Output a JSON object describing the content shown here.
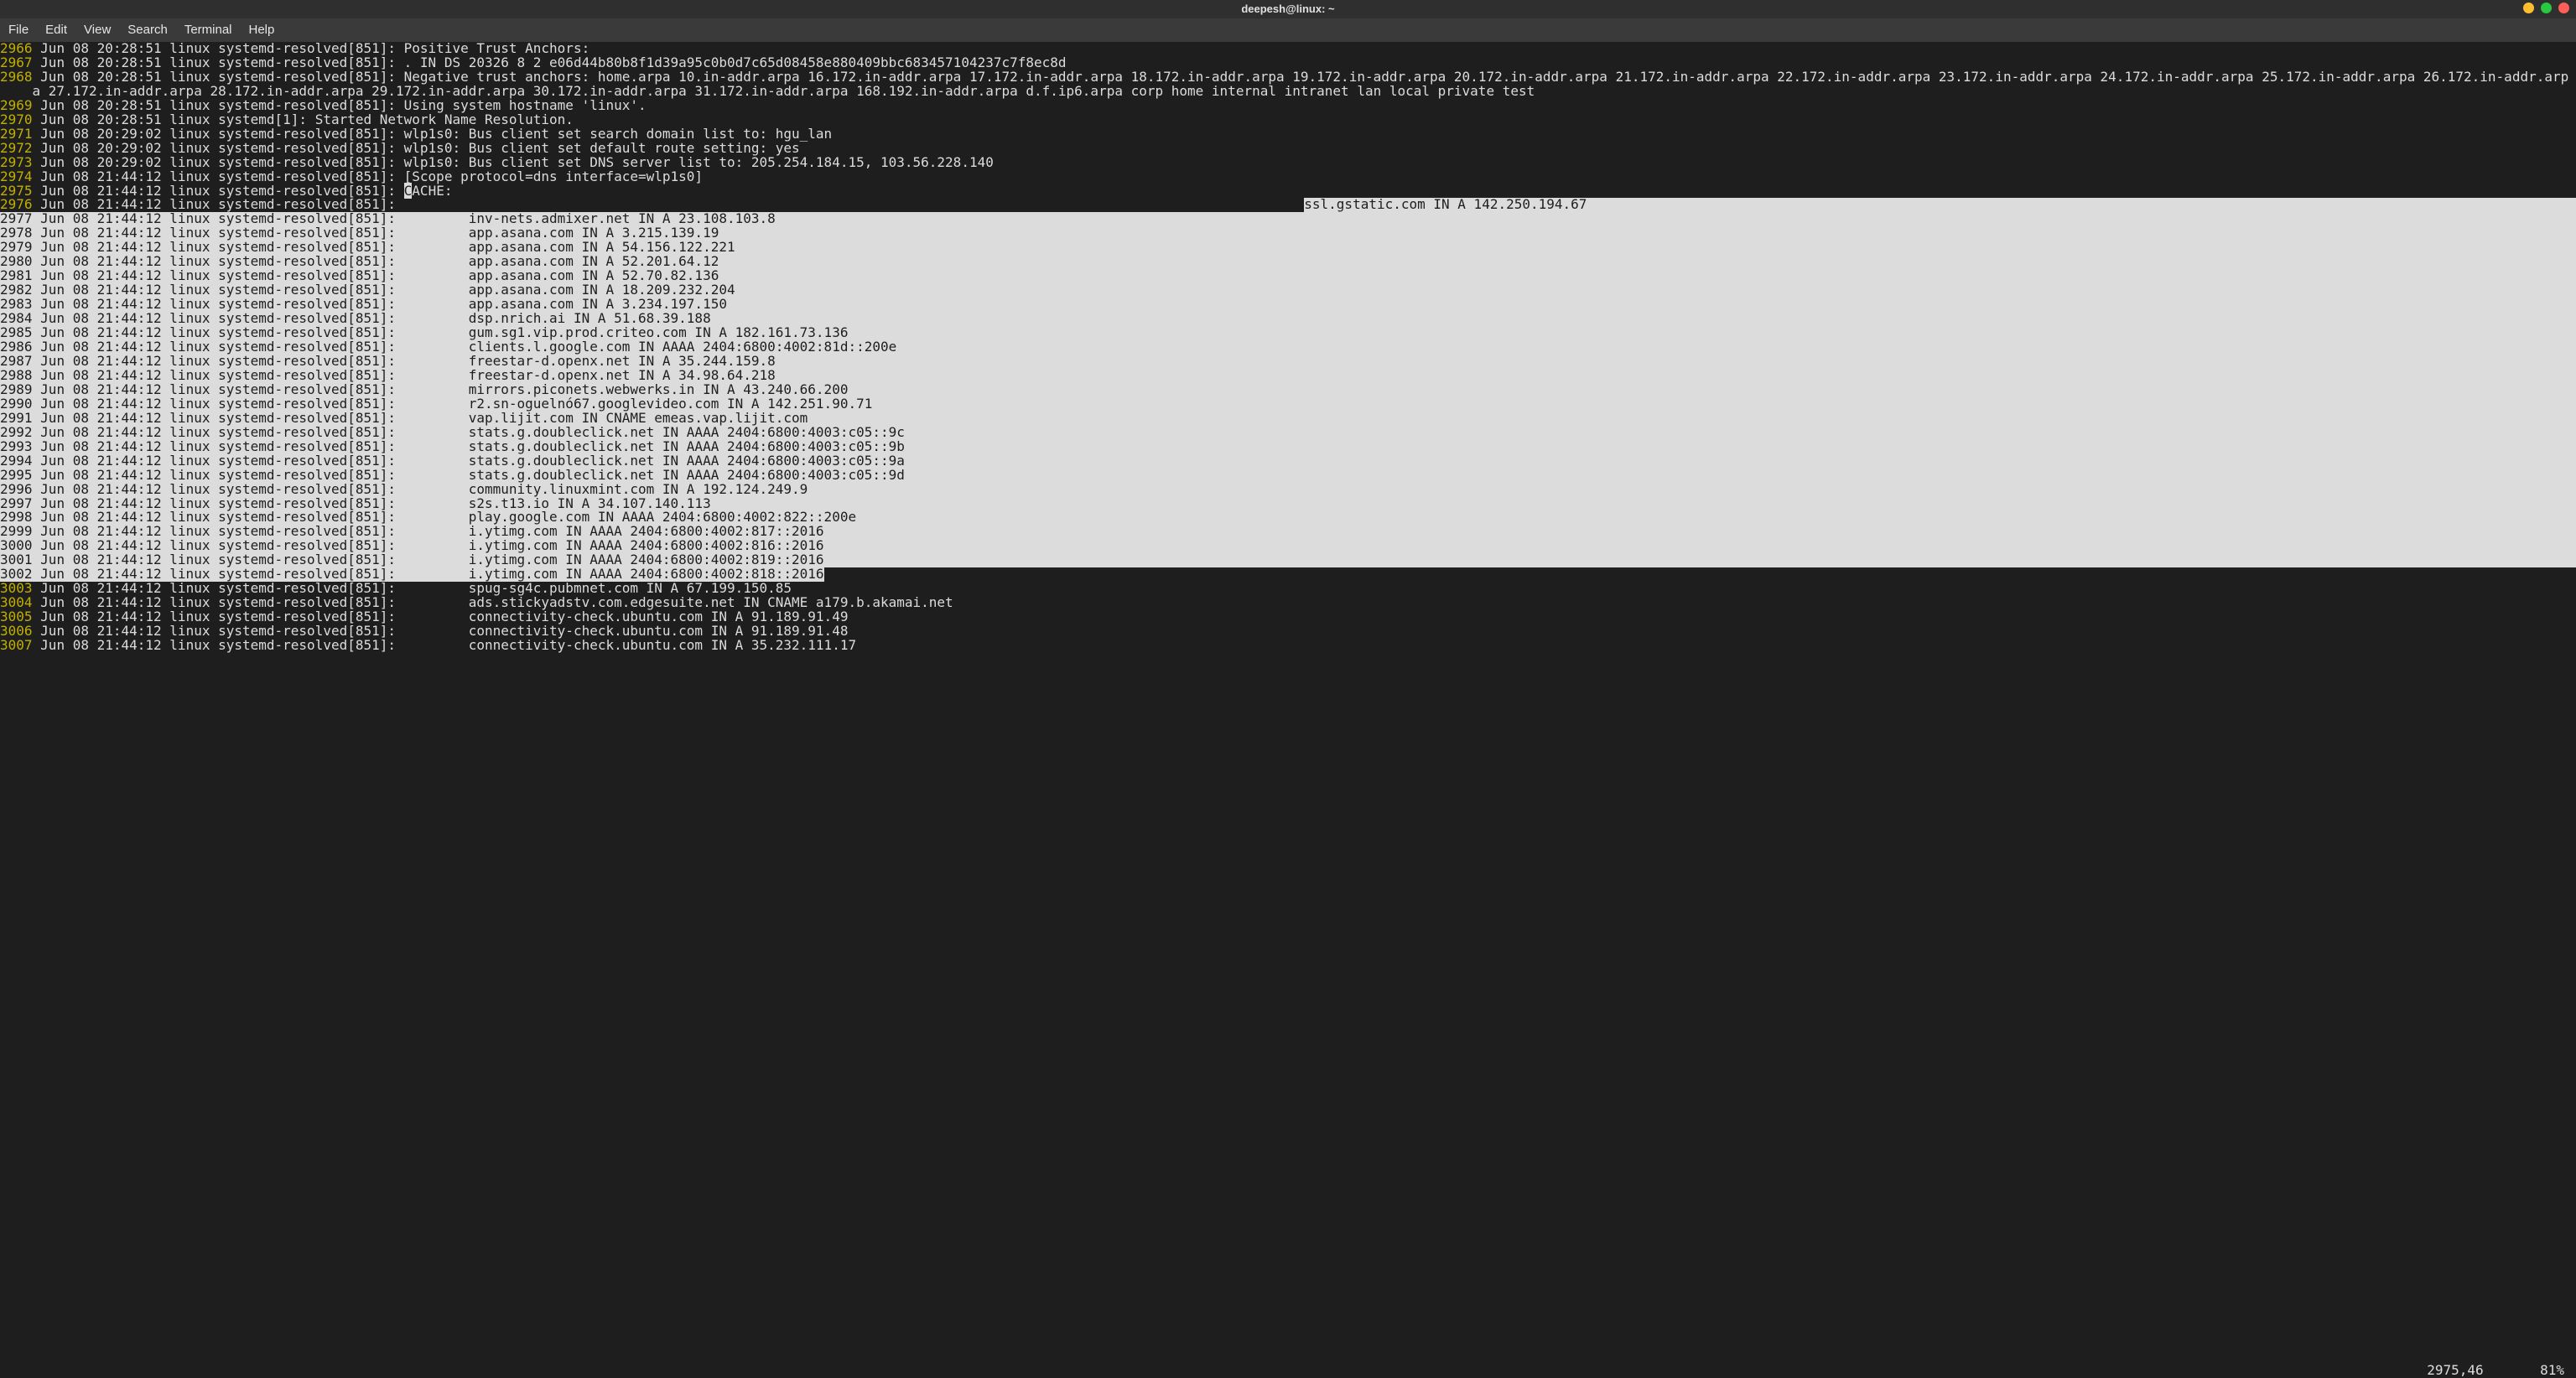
{
  "window": {
    "title": "deepesh@linux: ~"
  },
  "menubar": {
    "file": "File",
    "edit": "Edit",
    "view": "View",
    "search": "Search",
    "terminal": "Terminal",
    "help": "Help"
  },
  "status": {
    "pos": "2975,46",
    "pct": "81%"
  },
  "prefix_default": "Jun 08 21:44:12 linux systemd-resolved[851]:",
  "lines": [
    {
      "n": "2966",
      "text": "Jun 08 20:28:51 linux systemd-resolved[851]: Positive Trust Anchors:"
    },
    {
      "n": "2967",
      "text": "Jun 08 20:28:51 linux systemd-resolved[851]: . IN DS 20326 8 2 e06d44b80b8f1d39a95c0b0d7c65d08458e880409bbc683457104237c7f8ec8d"
    },
    {
      "n": "2968",
      "text": "Jun 08 20:28:51 linux systemd-resolved[851]: Negative trust anchors: home.arpa 10.in-addr.arpa 16.172.in-addr.arpa 17.172.in-addr.arpa 18.172.in-addr.arpa 19.172.in-addr.arpa 20.172.in-addr.arpa 21.172.in-addr.arpa 22.172.in-addr.arpa 23.172.in-addr.arpa 24.172.in-addr.arpa 25.172.in-addr.arpa 26.172.in-addr.arpa 27.172.in-addr.arpa 28.172.in-addr.arpa 29.172.in-addr.arpa 30.172.in-addr.arpa 31.172.in-addr.arpa 168.192.in-addr.arpa d.f.ip6.arpa corp home internal intranet lan local private test"
    },
    {
      "n": "2969",
      "text": "Jun 08 20:28:51 linux systemd-resolved[851]: Using system hostname 'linux'."
    },
    {
      "n": "2970",
      "text": "Jun 08 20:28:51 linux systemd[1]: Started Network Name Resolution."
    },
    {
      "n": "2971",
      "text": "Jun 08 20:29:02 linux systemd-resolved[851]: wlp1s0: Bus client set search domain list to: hgu_lan"
    },
    {
      "n": "2972",
      "text": "Jun 08 20:29:02 linux systemd-resolved[851]: wlp1s0: Bus client set default route setting: yes"
    },
    {
      "n": "2973",
      "text": "Jun 08 20:29:02 linux systemd-resolved[851]: wlp1s0: Bus client set DNS server list to: 205.254.184.15, 103.56.228.140"
    },
    {
      "n": "2974",
      "text": "Jun 08 21:44:12 linux systemd-resolved[851]: [Scope protocol=dns interface=wlp1s0]"
    }
  ],
  "cache_line": {
    "n": "2975",
    "cursor_char": "C",
    "rest": "ACHE:"
  },
  "selected_header": {
    "n": "2976",
    "rec": "ssl.gstatic.com IN A 142.250.194.67"
  },
  "selected": [
    {
      "n": "2977",
      "rec": "inv-nets.admixer.net IN A 23.108.103.8"
    },
    {
      "n": "2978",
      "rec": "app.asana.com IN A 3.215.139.19"
    },
    {
      "n": "2979",
      "rec": "app.asana.com IN A 54.156.122.221"
    },
    {
      "n": "2980",
      "rec": "app.asana.com IN A 52.201.64.12"
    },
    {
      "n": "2981",
      "rec": "app.asana.com IN A 52.70.82.136"
    },
    {
      "n": "2982",
      "rec": "app.asana.com IN A 18.209.232.204"
    },
    {
      "n": "2983",
      "rec": "app.asana.com IN A 3.234.197.150"
    },
    {
      "n": "2984",
      "rec": "dsp.nrich.ai IN A 51.68.39.188"
    },
    {
      "n": "2985",
      "rec": "gum.sg1.vip.prod.criteo.com IN A 182.161.73.136"
    },
    {
      "n": "2986",
      "rec": "clients.l.google.com IN AAAA 2404:6800:4002:81d::200e"
    },
    {
      "n": "2987",
      "rec": "freestar-d.openx.net IN A 35.244.159.8"
    },
    {
      "n": "2988",
      "rec": "freestar-d.openx.net IN A 34.98.64.218"
    },
    {
      "n": "2989",
      "rec": "mirrors.piconets.webwerks.in IN A 43.240.66.200"
    },
    {
      "n": "2990",
      "rec": "r2.sn-oguelnó67.googlevideo.com IN A 142.251.90.71"
    },
    {
      "n": "2991",
      "rec": "vap.lijit.com IN CNAME emeas.vap.lijit.com"
    },
    {
      "n": "2992",
      "rec": "stats.g.doubleclick.net IN AAAA 2404:6800:4003:c05::9c"
    },
    {
      "n": "2993",
      "rec": "stats.g.doubleclick.net IN AAAA 2404:6800:4003:c05::9b"
    },
    {
      "n": "2994",
      "rec": "stats.g.doubleclick.net IN AAAA 2404:6800:4003:c05::9a"
    },
    {
      "n": "2995",
      "rec": "stats.g.doubleclick.net IN AAAA 2404:6800:4003:c05::9d"
    },
    {
      "n": "2996",
      "rec": "community.linuxmint.com IN A 192.124.249.9"
    },
    {
      "n": "2997",
      "rec": "s2s.t13.io IN A 34.107.140.113"
    },
    {
      "n": "2998",
      "rec": "play.google.com IN AAAA 2404:6800:4002:822::200e"
    },
    {
      "n": "2999",
      "rec": "i.ytimg.com IN AAAA 2404:6800:4002:817::2016"
    },
    {
      "n": "3000",
      "rec": "i.ytimg.com IN AAAA 2404:6800:4002:816::2016"
    },
    {
      "n": "3001",
      "rec": "i.ytimg.com IN AAAA 2404:6800:4002:819::2016"
    }
  ],
  "selected_tail": {
    "n": "3002",
    "rec": "i.ytimg.com IN AAAA 2404:6800:4002:818::2016"
  },
  "plain_tail": [
    {
      "n": "3003",
      "rec": "spug-sg4c.pubmnet.com IN A 67.199.150.85"
    },
    {
      "n": "3004",
      "rec": "ads.stickyadstv.com.edgesuite.net IN CNAME a179.b.akamai.net"
    },
    {
      "n": "3005",
      "rec": "connectivity-check.ubuntu.com IN A 91.189.91.49"
    },
    {
      "n": "3006",
      "rec": "connectivity-check.ubuntu.com IN A 91.189.91.48"
    },
    {
      "n": "3007",
      "rec": "connectivity-check.ubuntu.com IN A 35.232.111.17"
    }
  ],
  "indent_spaces": "         "
}
